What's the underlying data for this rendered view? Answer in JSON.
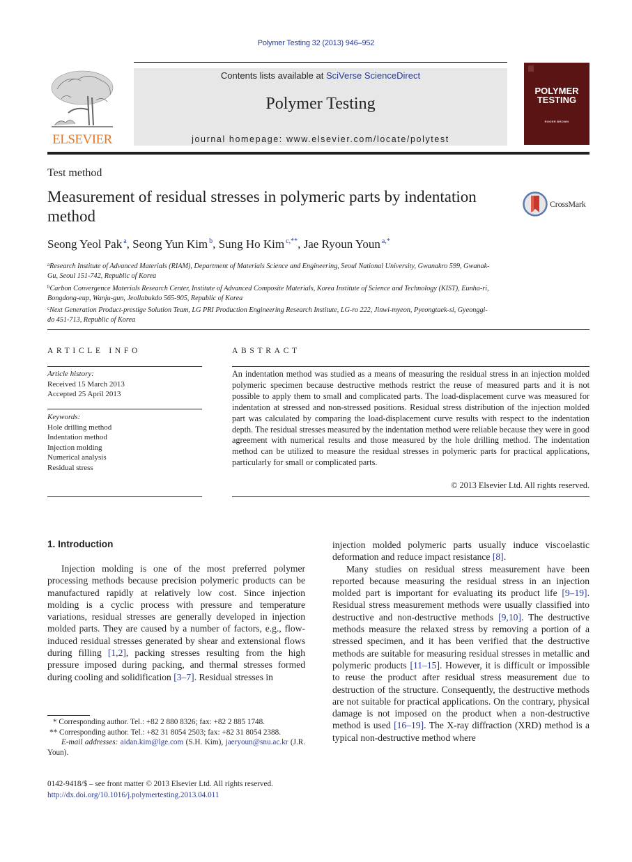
{
  "header": {
    "running_head": "Polymer Testing 32 (2013) 946–952",
    "contents_prefix": "Contents lists available at ",
    "contents_link": "SciVerse ScienceDirect",
    "journal_name": "Polymer Testing",
    "homepage": "journal homepage: www.elsevier.com/locate/polytest",
    "publisher_logo_text": "ELSEVIER",
    "cover_title_line1": "POLYMER",
    "cover_title_line2": "TESTING",
    "cover_editor": "ROGER BROWN",
    "colors": {
      "link": "#2a3c8f",
      "publisher_orange": "#e87722",
      "cover_bg": "#5a1414",
      "masthead_bg": "#e7e7e7"
    }
  },
  "article": {
    "type": "Test method",
    "title": "Measurement of residual stresses in polymeric parts by indentation method",
    "crossmark_label": "CrossMark",
    "authors": [
      {
        "name": "Seong Yeol Pak",
        "sup": "a",
        "sep": ", "
      },
      {
        "name": "Seong Yun Kim",
        "sup": "b",
        "sep": ", "
      },
      {
        "name": "Sung Ho Kim",
        "sup": "c,**",
        "sep": ", "
      },
      {
        "name": "Jae Ryoun Youn",
        "sup": "a,*",
        "sep": ""
      }
    ],
    "affiliations": [
      {
        "key": "a",
        "text": "Research Institute of Advanced Materials (RIAM), Department of Materials Science and Engineering, Seoul National University, Gwanakro 599, Gwanak-Gu, Seoul 151-742, Republic of Korea"
      },
      {
        "key": "b",
        "text": "Carbon Convergence Materials Research Center, Institute of Advanced Composite Materials, Korea Institute of Science and Technology (KIST), Eunha-ri, Bongdong-eup, Wanju-gun, Jeollabukdo 565-905, Republic of Korea"
      },
      {
        "key": "c",
        "text": "Next Generation Product-prestige Solution Team, LG PRI Production Engineering Research Institute, LG-ro 222, Jinwi-myeon, Pyeongtaek-si, Gyeonggi-do 451-713, Republic of Korea"
      }
    ]
  },
  "article_info": {
    "heading": "ARTICLE INFO",
    "history_label": "Article history:",
    "received": "Received 15 March 2013",
    "accepted": "Accepted 25 April 2013",
    "keywords_label": "Keywords:",
    "keywords": [
      "Hole drilling method",
      "Indentation method",
      "Injection molding",
      "Numerical analysis",
      "Residual stress"
    ]
  },
  "abstract": {
    "heading": "ABSTRACT",
    "text": "An indentation method was studied as a means of measuring the residual stress in an injection molded polymeric specimen because destructive methods restrict the reuse of measured parts and it is not possible to apply them to small and complicated parts. The load-displacement curve was measured for indentation at stressed and non-stressed po­sitions. Residual stress distribution of the injection molded part was calculated by comparing the load-displacement curve results with respect to the indentation depth. The residual stresses measured by the indentation method were reliable because they were in good agreement with numerical results and those measured by the hole drilling method. The indentation method can be utilized to measure the residual stresses in polymeric parts for practical applications, particularly for small or complicated parts.",
    "copyright": "© 2013 Elsevier Ltd. All rights reserved."
  },
  "body": {
    "section_heading": "1.  Introduction",
    "p1_a": "Injection molding is one of the most preferred polymer processing methods because precision polymeric products can be manufactured rapidly at relatively low cost. Since injection molding is a cyclic process with pressure and temperature variations, residual stresses are generally developed in injection molded parts. They are caused by a number of factors, e.g., flow-induced residual stresses generated by shear and extensional flows during filling ",
    "ref_1": "[1,2]",
    "p1_b": ", packing stresses resulting from the high pressure imposed during packing, and thermal stresses formed during cooling and solidification ",
    "ref_2": "[3–7]",
    "p1_c": ". Residual stresses in injection molded polymeric parts usually induce visco­elastic deformation and reduce impact resistance ",
    "ref_3": "[8]",
    "p1_d": ".",
    "p2_a": "Many studies on residual stress measurement have been reported because measuring the residual stress in an in­jection molded part is important for evaluating its product life ",
    "ref_4": "[9–19]",
    "p2_b": ". Residual stress measurement methods were usually classified into destructive and non-destructive methods ",
    "ref_5": "[9,10]",
    "p2_c": ". The destructive methods measure the relaxed stress by removing a portion of a stressed spec­imen, and it has been verified that the destructive methods are suitable for measuring residual stresses in metallic and polymeric products ",
    "ref_6": "[11–15]",
    "p2_d": ". However, it is difficult or impossible to reuse the product after residual stress mea­surement due to destruction of the structure. Conse­quently, the destructive methods are not suitable for practical applications. On the contrary, physical damage is not imposed on the product when a non-destructive method is used ",
    "ref_7": "[16–19]",
    "p2_e": ". The X-ray diffraction (XRD) method is a typical non-destructive method where"
  },
  "footnotes": {
    "corr1": "* Corresponding author. Tel.: +82 2 880 8326; fax: +82 2 885 1748.",
    "corr2": "** Corresponding author. Tel.: +82 31 8054 2503; fax: +82 31 8054 2388.",
    "email_label": "E-mail addresses:",
    "email1": "aidan.kim@lge.com",
    "email1_who": " (S.H. Kim), ",
    "email2": "jaeryoun@snu.ac.kr",
    "email2_who": " (J.R. Youn).",
    "issn_line": "0142-9418/$ – see front matter © 2013 Elsevier Ltd. All rights reserved.",
    "doi": "http://dx.doi.org/10.1016/j.polymertesting.2013.04.011"
  }
}
